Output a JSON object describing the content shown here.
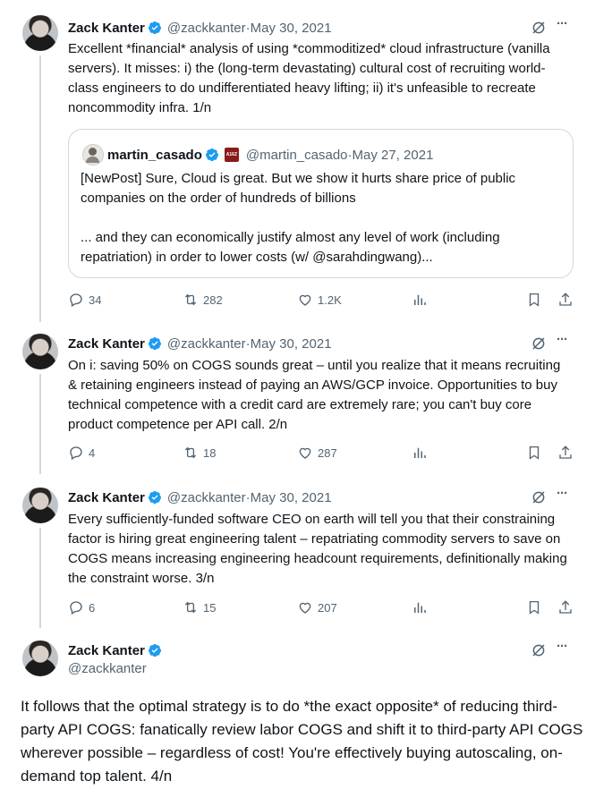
{
  "tweets": [
    {
      "name": "Zack Kanter",
      "handle": "@zackkanter",
      "date": "May 30, 2021",
      "text": "Excellent *financial* analysis of using *commoditized* cloud infrastructure (vanilla servers). It misses: i) the (long-term devastating) cultural cost of recruiting world-class engineers to do undifferentiated heavy lifting; ii) it's unfeasible to recreate noncommodity infra. 1/n",
      "replies": "34",
      "retweets": "282",
      "likes": "1.2K"
    },
    {
      "name": "Zack Kanter",
      "handle": "@zackkanter",
      "date": "May 30, 2021",
      "text": "On i: saving 50% on COGS sounds great – until you realize that it means recruiting & retaining engineers instead of paying an AWS/GCP invoice. Opportunities to buy technical competence with a credit card are extremely rare; you can't buy core product competence per API call. 2/n",
      "replies": "4",
      "retweets": "18",
      "likes": "287"
    },
    {
      "name": "Zack Kanter",
      "handle": "@zackkanter",
      "date": "May 30, 2021",
      "text": "Every sufficiently-funded software CEO on earth will tell you that their constraining factor is hiring great engineering talent – repatriating commodity servers to save on COGS means increasing engineering headcount requirements, definitionally making the constraint worse. 3/n",
      "replies": "6",
      "retweets": "15",
      "likes": "207"
    }
  ],
  "quote": {
    "name": "martin_casado",
    "handle": "@martin_casado",
    "date": "May 27, 2021",
    "text1": "[NewPost] Sure, Cloud is great. But we show it hurts share price of public companies on the order of hundreds of billions",
    "text2": "... and they can economically justify almost any level of work (including repatriation) in order to lower costs (w/ @sarahdingwang)...",
    "badge": "A16Z"
  },
  "main": {
    "name": "Zack Kanter",
    "handle": "@zackkanter",
    "text": "It follows that the optimal strategy is to do *the exact opposite* of reducing third-party API COGS: fanatically review labor COGS and shift it to third-party API COGS wherever possible – regardless of cost! You're effectively buying autoscaling, on-demand top talent. 4/n"
  },
  "separator": " · ",
  "more_label": "···",
  "colors": {
    "verified": "#1d9bf0",
    "muted": "#536471",
    "line": "#cfd9de"
  }
}
